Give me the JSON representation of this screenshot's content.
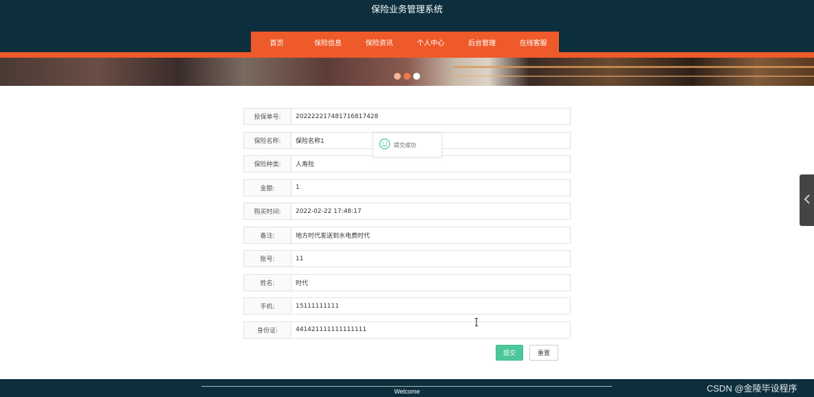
{
  "site": {
    "title": "保险业务管理系统"
  },
  "nav": {
    "items": [
      {
        "label": "首页"
      },
      {
        "label": "保险信息"
      },
      {
        "label": "保险资讯"
      },
      {
        "label": "个人中心"
      },
      {
        "label": "后台管理"
      },
      {
        "label": "在线客服"
      }
    ]
  },
  "carousel": {
    "dot_colors": [
      "#f4b49a",
      "#ef7a4a",
      "#ffffff"
    ]
  },
  "form": {
    "fields": [
      {
        "label": "投保单号:",
        "value": "2022222174817168174​28"
      },
      {
        "label": "保险名称:",
        "value": "保险名称1"
      },
      {
        "label": "保险种类:",
        "value": "人寿险"
      },
      {
        "label": "金额:",
        "value": "1"
      },
      {
        "label": "购买时间:",
        "value": "2022-02-22 17:48:17"
      },
      {
        "label": "备注:",
        "value": "地方时代发送到水电费时代"
      },
      {
        "label": "账号:",
        "value": "11"
      },
      {
        "label": "姓名:",
        "value": "时代"
      },
      {
        "label": "手机:",
        "value": "15111111111"
      },
      {
        "label": "身份证:",
        "value": "441421111111111111"
      }
    ],
    "submit_label": "提交",
    "reset_label": "重置"
  },
  "toast": {
    "message": "提交成功",
    "icon": "smile-icon"
  },
  "footer": {
    "text": "Welcome"
  },
  "watermark": {
    "text": "CSDN @金陵毕设程序"
  },
  "colors": {
    "header_bg": "#0d2f3d",
    "accent": "#ef5a2a",
    "submit": "#4cc79b"
  }
}
